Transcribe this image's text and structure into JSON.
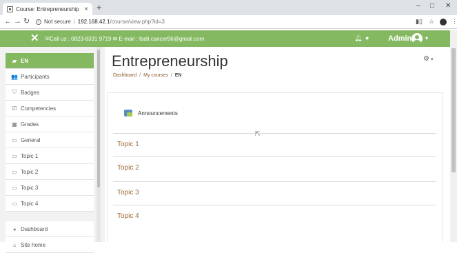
{
  "browser": {
    "tab_title": "Course: Entrepreneurship",
    "tab_close": "×",
    "new_tab": "+",
    "window": {
      "minimize": "–",
      "maximize": "□",
      "close": "✕"
    },
    "address": {
      "security_label": "Not secure",
      "host": "192.168.42.1",
      "path": "/course/view.php?id=3"
    }
  },
  "navbar": {
    "contact": "Call us : 0823-8331 9719 ✉ E-mail : fadli.cancer96@gmail.com",
    "user_name": "Admin",
    "color": "#85b961"
  },
  "sidebar": {
    "items": [
      {
        "label": "EN",
        "icon": "graduation-cap-icon",
        "glyph": "▰",
        "active": true
      },
      {
        "label": "Participants",
        "icon": "users-icon",
        "glyph": "👥"
      },
      {
        "label": "Badges",
        "icon": "shield-icon",
        "glyph": "⛉"
      },
      {
        "label": "Competencies",
        "icon": "checkbox-icon",
        "glyph": "☑"
      },
      {
        "label": "Grades",
        "icon": "table-icon",
        "glyph": "▦"
      },
      {
        "label": "General",
        "icon": "folder-icon",
        "glyph": "▭"
      },
      {
        "label": "Topic 1",
        "icon": "folder-icon",
        "glyph": "▭"
      },
      {
        "label": "Topic 2",
        "icon": "folder-icon",
        "glyph": "▭"
      },
      {
        "label": "Topic 3",
        "icon": "folder-icon",
        "glyph": "▭"
      },
      {
        "label": "Topic 4",
        "icon": "folder-icon",
        "glyph": "▭"
      }
    ],
    "footer_items": [
      {
        "label": "Dashboard",
        "icon": "dashboard-icon",
        "glyph": "◕"
      },
      {
        "label": "Site home",
        "icon": "home-icon",
        "glyph": "⌂"
      }
    ]
  },
  "main": {
    "title": "Entrepreneurship",
    "breadcrumb": {
      "dashboard": "Dashboard",
      "my_courses": "My courses",
      "current": "EN",
      "separator": "/"
    },
    "announcement": "Announcements",
    "topics": [
      "Topic 1",
      "Topic 2",
      "Topic 3",
      "Topic 4"
    ]
  }
}
